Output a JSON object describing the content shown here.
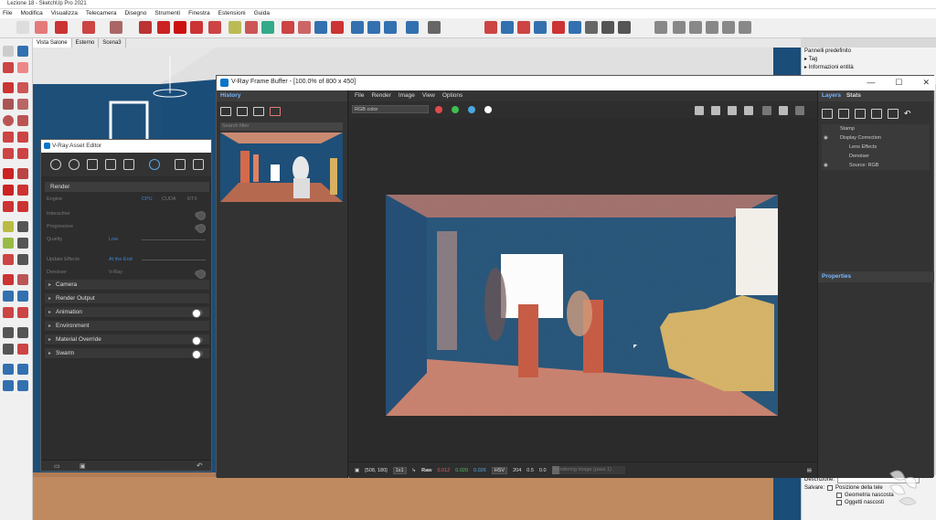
{
  "sketchup": {
    "title": "Lezione 18 - SketchUp Pro 2021",
    "window_controls": [
      "—",
      "❐",
      "✕"
    ],
    "menu": [
      "File",
      "Modifica",
      "Visualizza",
      "Telecamera",
      "Disegno",
      "Strumenti",
      "Finestra",
      "Estensioni",
      "Guida"
    ],
    "scene_tabs": [
      "Vista Salone",
      "Esterno",
      "Scena3"
    ],
    "default_panels": {
      "title": "Pannelli predefinito",
      "items": [
        "Tag",
        "Informazioni entità"
      ]
    },
    "bottom_panel": {
      "descr_label": "Descrizione:",
      "save_label": "Salvare:",
      "checks": [
        "Posizione della tele",
        "Geometria nascosta",
        "Oggetti nascosti"
      ]
    }
  },
  "vfb": {
    "title": "V-Ray Frame Buffer - [100.0% of 800 x 450]",
    "window_controls": [
      "—",
      "☐",
      "✕"
    ],
    "history": {
      "tab": "History",
      "search_placeholder": "Search filter"
    },
    "menu": [
      "File",
      "Render",
      "Image",
      "View",
      "Options"
    ],
    "channel_select": "RGB color",
    "channel_dot_colors": [
      "#e04b4b",
      "#3fbf4f",
      "#4aa8e0",
      "#ffffff"
    ],
    "status": {
      "coords": "[508, 180]",
      "zoom": "1x1",
      "raw_label": "Raw",
      "r": "0.012",
      "g": "0.020",
      "b": "0.026",
      "mode": "HSV",
      "h": "204",
      "s": "0.5",
      "v": "0.0",
      "progress_text": "Rendering image (pass 1)"
    },
    "layers": {
      "tabs": [
        "Layers",
        "Stats"
      ],
      "rows": [
        "Stamp",
        "Display Correction",
        "Lens Effects",
        "Denoiser",
        "Source: RGB"
      ],
      "properties_label": "Properties"
    }
  },
  "asset_editor": {
    "title": "V-Ray Asset Editor",
    "render_section": "Render",
    "engine_label": "Engine",
    "engine_options": [
      "CPU",
      "CUDA",
      "RTX"
    ],
    "interactive_label": "Interactive",
    "progressive_label": "Progressive",
    "quality_label": "Quality",
    "quality_value": "Low",
    "update_effects_label": "Update Effects",
    "update_effects_value": "At the End",
    "denoiser_label": "Denoiser",
    "denoiser_value": "V-Ray",
    "sections": [
      "Camera",
      "Render Output",
      "Animation",
      "Environment",
      "Material Override",
      "Swarm"
    ]
  }
}
